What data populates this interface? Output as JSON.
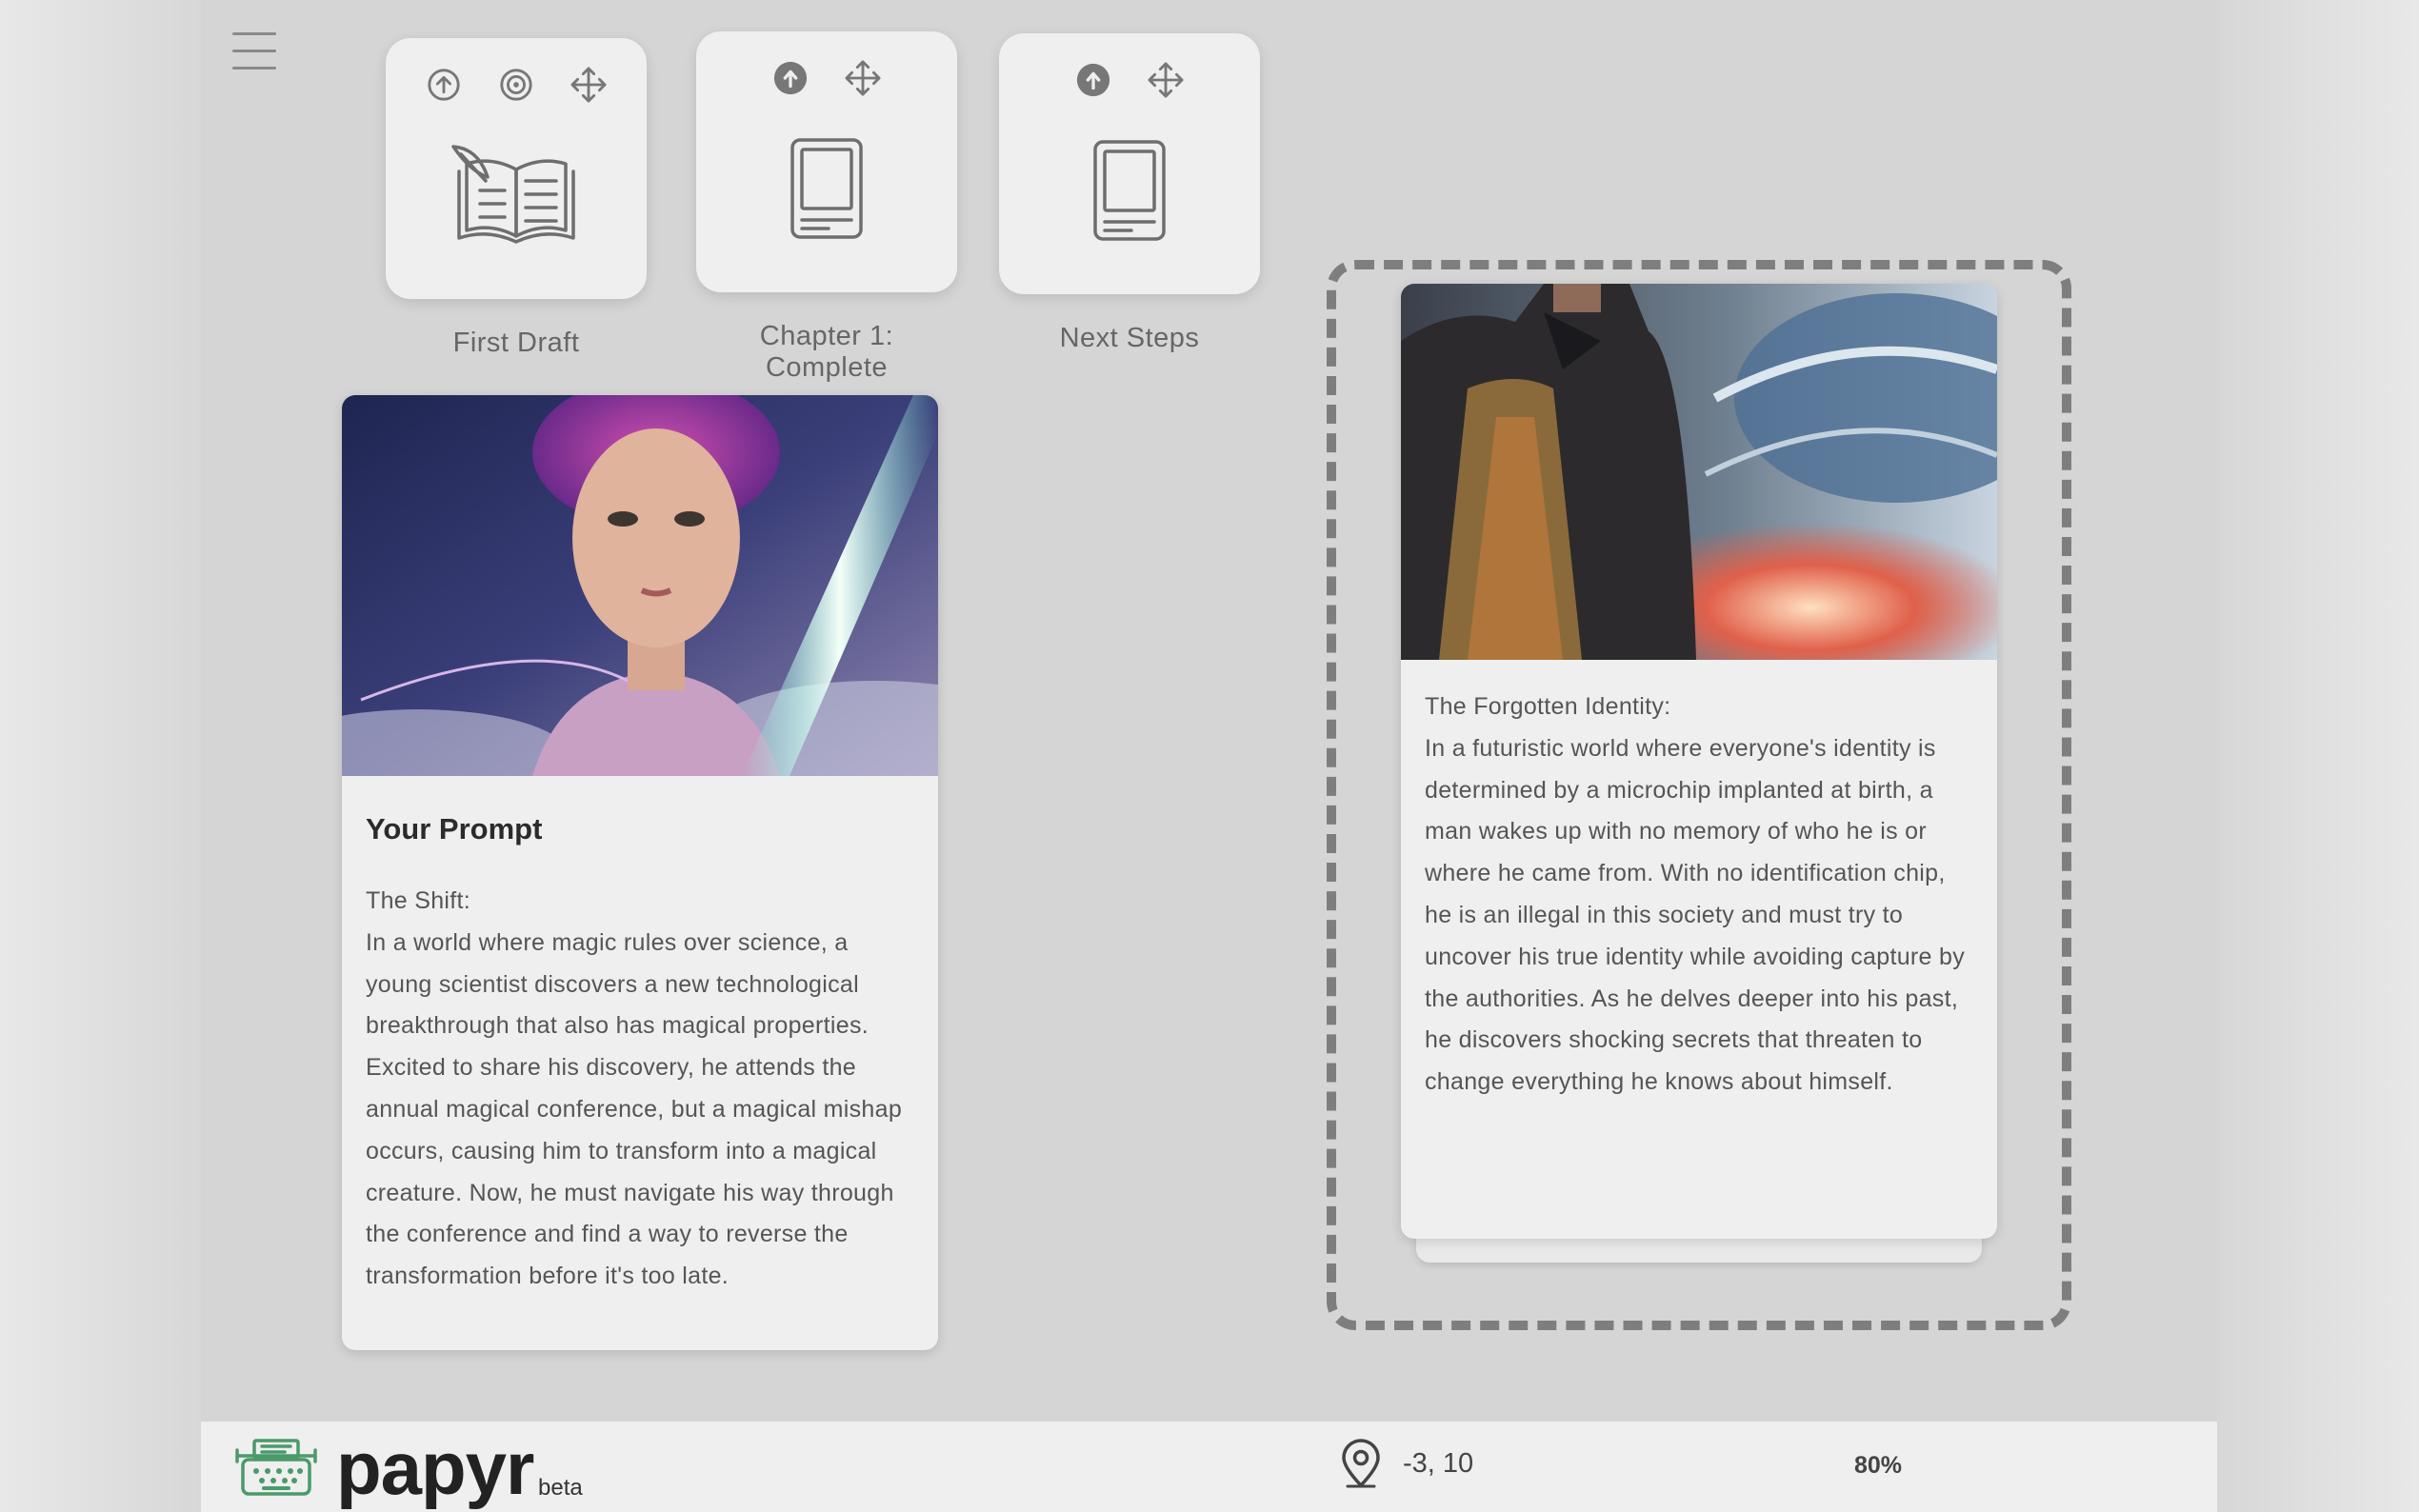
{
  "toolbar": {
    "menu_icon": "hamburger-menu-icon"
  },
  "nodes": [
    {
      "label": "First Draft",
      "icons": [
        "upload-circle-icon",
        "target-icon",
        "move-icon"
      ],
      "main_icon": "open-book-quill-icon"
    },
    {
      "label": "Chapter 1: Complete",
      "icons": [
        "upload-filled-icon",
        "move-icon"
      ],
      "main_icon": "tablet-document-icon"
    },
    {
      "label": "Next Steps",
      "icons": [
        "upload-filled-icon",
        "move-icon"
      ],
      "main_icon": "tablet-document-icon"
    }
  ],
  "prompt_card": {
    "title": "Your Prompt",
    "story_title": "The Shift:",
    "story_text": "In a world where magic rules over science, a young scientist discovers a new technological breakthrough that also has magical properties. Excited to share his discovery, he attends the annual magical conference, but a magical mishap occurs, causing him to transform into a magical creature. Now, he must navigate his way through the conference and find a way to reverse the transformation before it's too late."
  },
  "story_card": {
    "story_title": "The Forgotten Identity:",
    "story_text": "In a futuristic world where everyone's identity is determined by a microchip implanted at birth, a man wakes up with no memory of who he is or where he came from. With no identification chip, he is an illegal in this society and must try to uncover his true identity while avoiding capture by the authorities. As he delves deeper into his past, he discovers shocking secrets that threaten to change everything he knows about himself."
  },
  "footer": {
    "brand": "papyr",
    "badge": "beta",
    "location_icon": "map-pin-icon",
    "coordinates": "-3, 10",
    "zoom": "80%",
    "accent_color": "#4a9a6a"
  }
}
